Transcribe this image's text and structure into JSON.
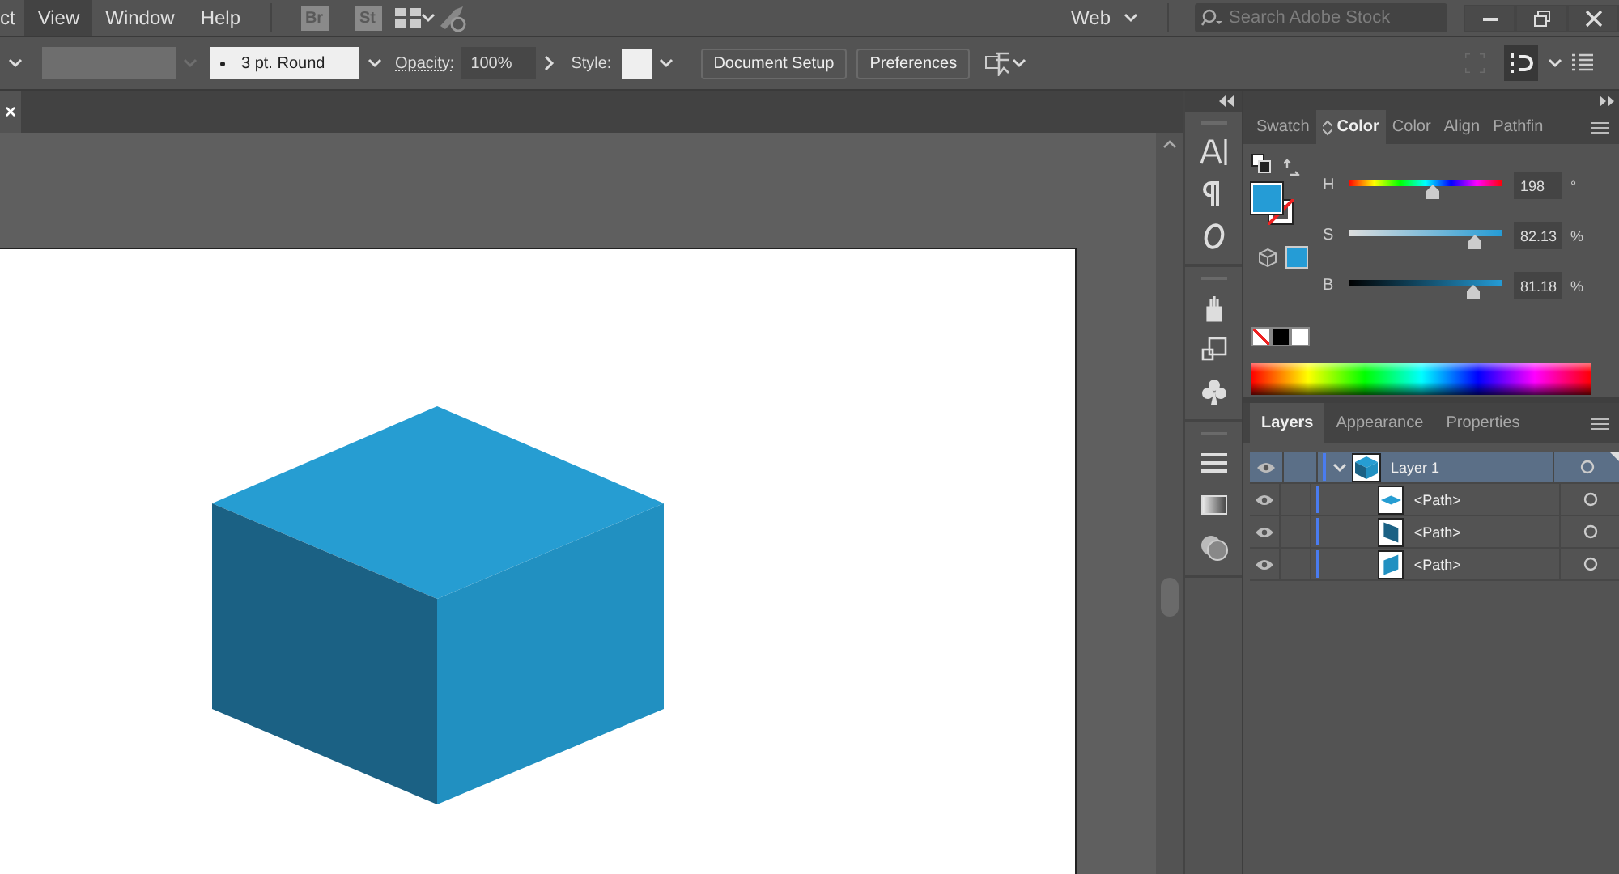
{
  "menu_bar": {
    "items": [
      {
        "label": "ct",
        "selected": false
      },
      {
        "label": "View",
        "selected": true
      },
      {
        "label": "Window",
        "selected": false
      },
      {
        "label": "Help",
        "selected": false
      }
    ],
    "app_badges": [
      "Br",
      "St"
    ],
    "workspace": "Web",
    "search": {
      "placeholder": "Search Adobe Stock"
    }
  },
  "control_bar": {
    "stroke": "3 pt. Round",
    "opacity_label": "Opacity:",
    "opacity_value": "100%",
    "style_label": "Style:",
    "buttons": [
      "Document Setup",
      "Preferences"
    ]
  },
  "document_tab": {
    "close": "×"
  },
  "color_panel": {
    "tabs": [
      {
        "label": "Swatch",
        "selected": false
      },
      {
        "label": "Color",
        "selected": true
      },
      {
        "label": "Color",
        "selected": false
      },
      {
        "label": "Align",
        "selected": false
      },
      {
        "label": "Pathfin",
        "selected": false
      }
    ],
    "sliders": [
      {
        "label": "H",
        "kind": "hue",
        "level": 0.55,
        "value": "198",
        "unit": "°"
      },
      {
        "label": "S",
        "kind": "saturation",
        "level": 0.82,
        "value": "82.13",
        "unit": "%"
      },
      {
        "label": "B",
        "kind": "brightness",
        "level": 0.81,
        "value": "81.18",
        "unit": "%"
      }
    ]
  },
  "layers_panel": {
    "tabs": [
      {
        "label": "Layers",
        "selected": true
      },
      {
        "label": "Appearance",
        "selected": false
      },
      {
        "label": "Properties",
        "selected": false
      }
    ],
    "layers": [
      {
        "name": "Layer 1",
        "kind": "cube",
        "visible": true,
        "selected": true,
        "expanded": true,
        "children": [
          {
            "name": "<Path>",
            "kind": "top",
            "visible": true,
            "selected": false
          },
          {
            "name": "<Path>",
            "kind": "left",
            "visible": true,
            "selected": false
          },
          {
            "name": "<Path>",
            "kind": "right",
            "visible": true,
            "selected": false
          }
        ]
      }
    ]
  }
}
